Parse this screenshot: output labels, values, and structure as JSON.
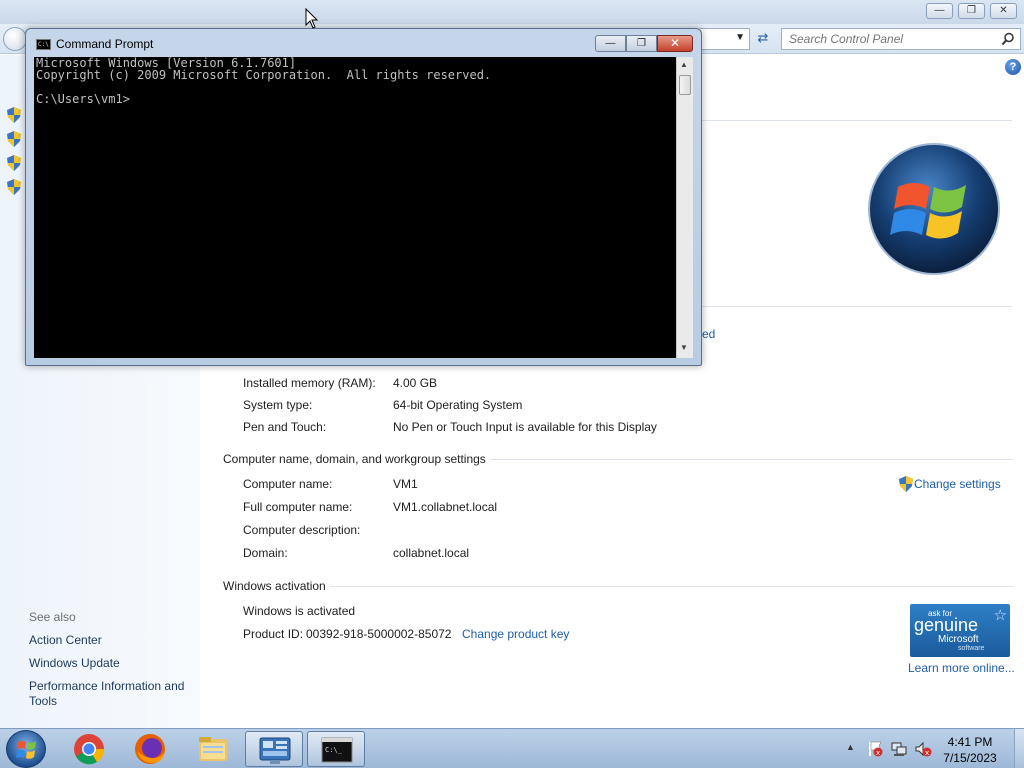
{
  "control_panel": {
    "search_placeholder": "Search Control Panel",
    "partial_link": "ed",
    "rows_hardware": [
      {
        "label": "Installed memory (RAM):",
        "value": "4.00 GB"
      },
      {
        "label": "System type:",
        "value": "64-bit Operating System"
      },
      {
        "label": "Pen and Touch:",
        "value": "No Pen or Touch Input is available for this Display"
      }
    ],
    "computer_section": {
      "title": "Computer name, domain, and workgroup settings",
      "change_settings": "Change settings",
      "rows": [
        {
          "label": "Computer name:",
          "value": "VM1"
        },
        {
          "label": "Full computer name:",
          "value": "VM1.collabnet.local"
        },
        {
          "label": "Computer description:",
          "value": ""
        },
        {
          "label": "Domain:",
          "value": "collabnet.local"
        }
      ]
    },
    "activation": {
      "title": "Windows activation",
      "status": "Windows is activated",
      "product_id_label": "Product ID:",
      "product_id": "00392-918-5000002-85072",
      "change_key": "Change product key",
      "learn_more": "Learn more online...",
      "genuine_askfor": "ask for",
      "genuine_word": "genuine",
      "genuine_microsoft": "Microsoft",
      "genuine_software": "software"
    },
    "see_also": {
      "title": "See also",
      "items": [
        "Action Center",
        "Windows Update",
        "Performance Information and",
        "Tools"
      ]
    }
  },
  "cmd": {
    "title": "Command Prompt",
    "icon_text": "C:\\",
    "lines": "Microsoft Windows [Version 6.1.7601]\nCopyright (c) 2009 Microsoft Corporation.  All rights reserved.\n\nC:\\Users\\vm1>"
  },
  "taskbar": {
    "items": [
      "start-orb",
      "chrome",
      "firefox",
      "file-explorer",
      "control-panel",
      "command-prompt"
    ],
    "clock_time": "4:41 PM",
    "clock_date": "7/15/2023"
  },
  "colors": {
    "link": "#1f5ea8",
    "console_bg": "#000000",
    "console_fg": "#c0c0c0",
    "taskbar": "#a9c2de"
  }
}
